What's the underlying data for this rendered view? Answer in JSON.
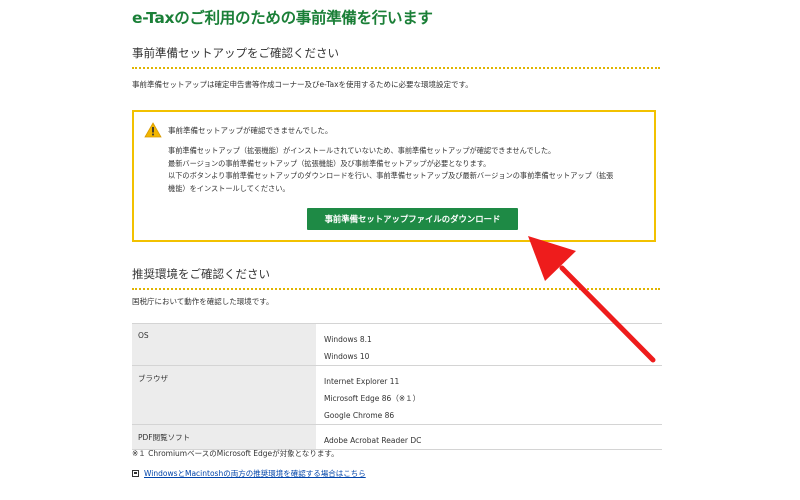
{
  "page": {
    "title": "e-Taxのご利用のための事前準備を行います"
  },
  "setup_section": {
    "heading": "事前準備セットアップをご確認ください",
    "description": "事前準備セットアップは確定申告書等作成コーナー及びe-Taxを使用するために必要な環境設定です。"
  },
  "warning": {
    "icon": "warning-triangle-icon",
    "title": "事前準備セットアップが確認できませんでした。",
    "lines": [
      "事前準備セットアップ（拡張機能）がインストールされていないため、事前準備セットアップが確認できませんでした。",
      "最新バージョンの事前準備セットアップ（拡張機能）及び事前準備セットアップが必要となります。",
      "以下のボタンより事前準備セットアップのダウンロードを行い、事前準備セットアップ及び最新バージョンの事前準備セットアップ（拡張",
      "機能）をインストールしてください。"
    ],
    "button_label": "事前準備セットアップファイルのダウンロード",
    "border_color": "#f2c100",
    "button_color": "#1e8a45"
  },
  "env_section": {
    "heading": "推奨環境をご確認ください",
    "description": "国税庁において動作を確認した環境です。",
    "rows": [
      {
        "label": "OS",
        "values": [
          "Windows 8.1",
          "Windows 10"
        ]
      },
      {
        "label": "ブラウザ",
        "values": [
          "Internet Explorer 11",
          "Microsoft Edge 86（※１）",
          "Google Chrome 86"
        ]
      },
      {
        "label": "PDF閲覧ソフト",
        "values": [
          "Adobe Acrobat Reader DC"
        ]
      }
    ],
    "footnote": "※１ ChromiumベースのMicrosoft Edgeが対象となります。",
    "link_text": "WindowsとMacintoshの両方の推奨環境を確認する場合はこちら"
  },
  "annotation": {
    "arrow_color": "#ee1c1c"
  }
}
